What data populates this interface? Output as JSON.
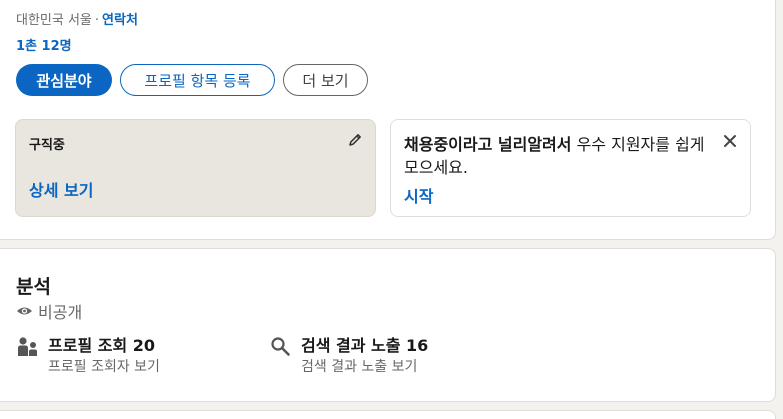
{
  "profile": {
    "location": "대한민국 서울",
    "separator": "·",
    "contact_link": "연락처",
    "connections": "1촌 12명",
    "buttons": {
      "open_to": "관심분야",
      "add_section": "프로필 항목 등록",
      "more": "더 보기"
    },
    "open_to_work": {
      "title": "구직중",
      "link": "상세 보기"
    },
    "hiring": {
      "text_bold": "채용중이라고 널리알려서",
      "text_rest": " 우수 지원자를 쉽게 모으세요.",
      "link": "시작"
    }
  },
  "analytics": {
    "title": "분석",
    "visibility": "비공개",
    "profile_views": {
      "label": "프로필 조회 20",
      "sub": "프로필 조회자 보기"
    },
    "search_appearances": {
      "label": "검색 결과 노출 16",
      "sub": "검색 결과 노출 보기"
    }
  },
  "colors": {
    "accent": "#0a66c2",
    "background": "#f4f2ee",
    "otw_box": "#e9e5df"
  },
  "icons": [
    "pencil-icon",
    "close-icon",
    "eye-icon",
    "people-icon",
    "search-icon"
  ]
}
